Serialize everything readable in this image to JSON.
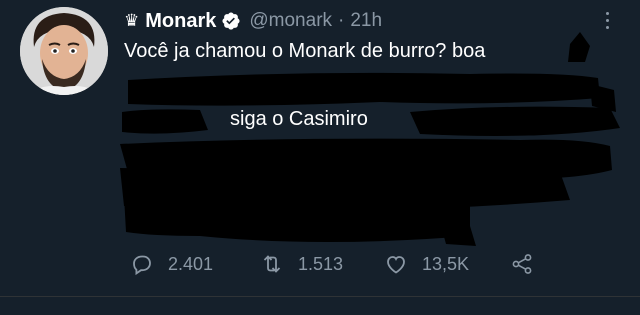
{
  "tweet": {
    "display_name": "Monark",
    "crown_glyph": "♛",
    "handle": "@monark",
    "separator": "·",
    "time": "21h",
    "text_line1": "Você ja chamou o Monark de burro? boa",
    "text_line2": "siga o Casimiro",
    "stats": {
      "replies": "2.401",
      "retweets": "1.513",
      "likes": "13,5K"
    }
  },
  "colors": {
    "background": "#15202b",
    "text": "#ffffff",
    "muted": "#8b98a5",
    "verified": "#1d9bf0"
  },
  "icons": [
    "crown-icon",
    "verified-icon",
    "more-icon",
    "reply-icon",
    "retweet-icon",
    "like-icon",
    "share-icon"
  ]
}
